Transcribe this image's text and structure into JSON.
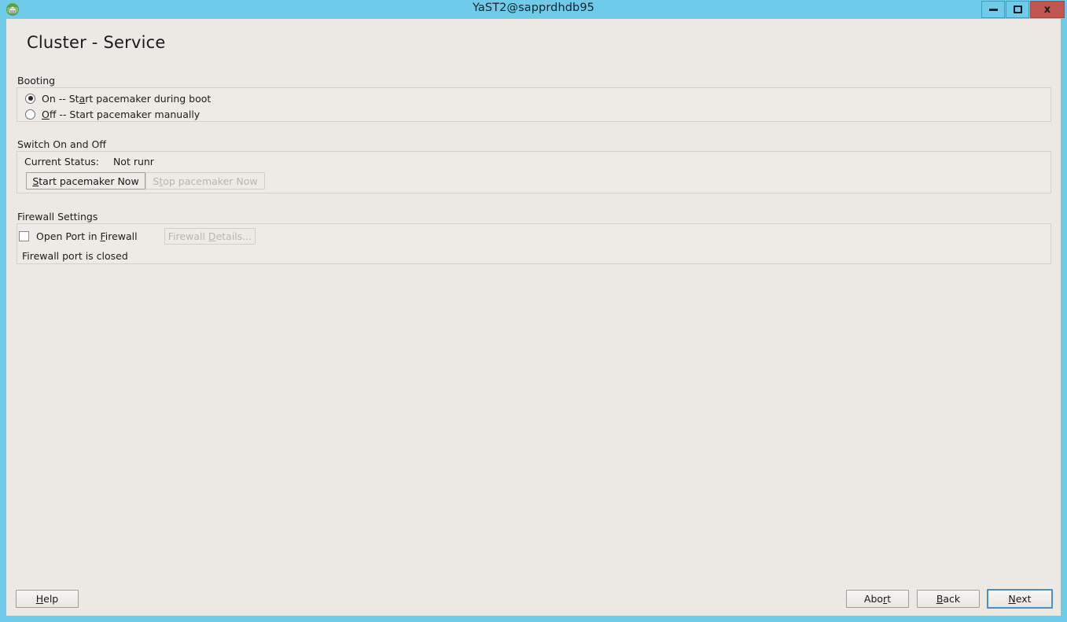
{
  "window": {
    "title": "YaST2@sapprdhdb95",
    "icon": "yast-globe-icon",
    "controls": {
      "minimize": "minimize-icon",
      "maximize": "maximize-icon",
      "close": "x"
    }
  },
  "page": {
    "title": "Cluster - Service"
  },
  "booting": {
    "section_label": "Booting",
    "options": [
      {
        "id": "on",
        "pre": "On -- St",
        "accel": "a",
        "post": "rt pacemaker during boot",
        "selected": true
      },
      {
        "id": "off",
        "pre": "",
        "accel": "O",
        "post": "ff -- Start pacemaker manually",
        "selected": false
      }
    ]
  },
  "switch_on_off": {
    "section_label": "Switch On and Off",
    "status_label": "Current Status:",
    "status_value": "Not runr",
    "start_button": {
      "pre": "",
      "accel": "S",
      "post": "tart pacemaker Now",
      "enabled": true
    },
    "stop_button": {
      "pre": "S",
      "accel": "t",
      "post": "op pacemaker Now",
      "enabled": false
    }
  },
  "firewall": {
    "section_label": "Firewall Settings",
    "checkbox": {
      "pre": "Open Port in ",
      "accel": "F",
      "post": "irewall",
      "checked": false
    },
    "details_button": {
      "pre": "Firewall ",
      "accel": "D",
      "post": "etails...",
      "enabled": false
    },
    "status_text": "Firewall port is closed"
  },
  "footer": {
    "help": {
      "pre": "",
      "accel": "H",
      "post": "elp"
    },
    "abort": {
      "pre": "Abo",
      "accel": "r",
      "post": "t"
    },
    "back": {
      "pre": "",
      "accel": "B",
      "post": "ack"
    },
    "next": {
      "pre": "",
      "accel": "N",
      "post": "ext",
      "focused": true
    }
  },
  "colors": {
    "frame": "#6ecbea",
    "client_bg": "#ece9e4",
    "group_bg": "#eeebe6",
    "close_btn": "#c0564f",
    "focus_border": "#4a90c4"
  }
}
